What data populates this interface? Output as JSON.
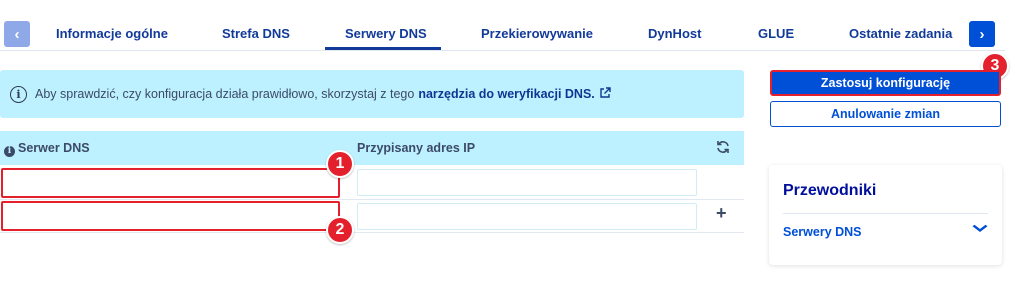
{
  "tabs": {
    "prev_icon": "chevron-left-icon",
    "next_icon": "chevron-right-icon",
    "prev_glyph": "‹",
    "next_glyph": "›",
    "items": [
      {
        "label": "Informacje ogólne"
      },
      {
        "label": "Strefa DNS"
      },
      {
        "label": "Serwery DNS",
        "active": true
      },
      {
        "label": "Przekierowywanie"
      },
      {
        "label": "DynHost"
      },
      {
        "label": "GLUE"
      },
      {
        "label": "Ostatnie zadania"
      }
    ]
  },
  "info": {
    "text": "Aby sprawdzić, czy konfiguracja działa prawidłowo, skorzystaj z tego",
    "link": "narzędzia do weryfikacji DNS.",
    "icon": "info-circle-icon"
  },
  "table": {
    "col_server": "Serwer DNS",
    "col_ip": "Przypisany adres IP",
    "rows": [
      {
        "server": "",
        "ip": ""
      },
      {
        "server": "",
        "ip": ""
      }
    ],
    "refresh_icon": "refresh-icon",
    "add_icon": "plus-icon"
  },
  "markers": [
    "1",
    "2",
    "3"
  ],
  "actions": {
    "apply_label": "Zastosuj konfigurację",
    "cancel_label": "Anulowanie zmian"
  },
  "guides": {
    "title": "Przewodniki",
    "item": "Serwery DNS"
  },
  "colors": {
    "primary": "#0050d7",
    "navy": "#000e9c",
    "info_bg": "#bef1ff",
    "marker_red": "#e3202b"
  }
}
